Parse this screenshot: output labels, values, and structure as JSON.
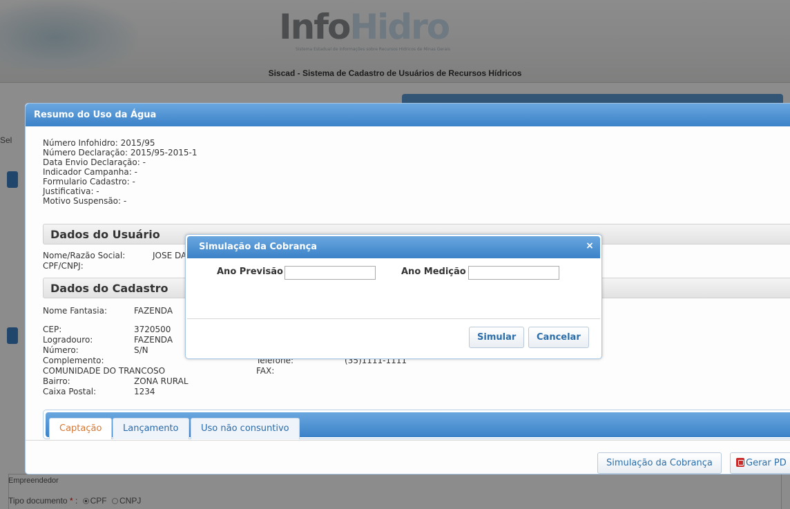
{
  "header": {
    "logo_part1": "Info",
    "logo_part2": "Hidro",
    "logo_subtitle": "Sistema Estadual de Informações sobre Recursos Hídricos de Minas Gerais",
    "system_title": "Siscad - Sistema de Cadastro de Usuários de Recursos Hídricos"
  },
  "background": {
    "sel_text": "Sel",
    "empreendedor_label": "Empreendedor",
    "tipo_documento_label": "Tipo documento",
    "required_mark": "*",
    "tipo_options": [
      "CPF",
      "CNPJ"
    ],
    "tipo_selected": "CPF"
  },
  "resumo": {
    "title": "Resumo do Uso da Água",
    "info": [
      "Número Infohidro: 2015/95",
      "Número Declaração: 2015/95-2015-1",
      "Data Envio Declaração: -",
      "Indicador Campanha: -",
      "Formulario Cadastro: -",
      "Justificativa: -",
      "Motivo Suspensão: -"
    ],
    "usuario": {
      "section_title": "Dados do Usuário",
      "nome_label": "Nome/Razão Social:",
      "nome_value": "JOSE DA",
      "cpf_label": "CPF/CNPJ:"
    },
    "cadastro": {
      "section_title": "Dados do Cadastro",
      "nome_fantasia_label": "Nome Fantasia:",
      "nome_fantasia_value": "FAZENDA",
      "cep_label": "CEP:",
      "cep_value": "3720500",
      "logradouro_label": "Logradouro:",
      "logradouro_value": "FAZENDA",
      "numero_label": "Número:",
      "numero_value": "S/N",
      "complemento_label": "Complemento:",
      "complemento_value": "COMUNIDADE DO TRANCOSO",
      "bairro_label": "Bairro:",
      "bairro_value": "ZONA RURAL",
      "caixa_postal_label": "Caixa Postal:",
      "caixa_postal_value": "1234",
      "telefone_label": "Telefone:",
      "telefone_value": "(35)1111-1111",
      "fax_label": "FAX:"
    },
    "tabs": [
      "Captação",
      "Lançamento",
      "Uso não consuntivo"
    ],
    "active_tab": "Captação",
    "buttons": {
      "simulacao": "Simulação da Cobrança",
      "gerar_pdf": "Gerar PD"
    }
  },
  "simulacao_dialog": {
    "title": "Simulação da Cobrança",
    "close_glyph": "×",
    "ano_previsao_label": "Ano Previsão",
    "ano_previsao_value": "",
    "ano_medicao_label": "Ano Medição",
    "ano_medicao_value": "",
    "simular_button": "Simular",
    "cancelar_button": "Cancelar"
  },
  "colors": {
    "header_blue": "#3b82c8",
    "active_tab_text": "#d8762f",
    "button_text": "#2b6ea9"
  }
}
